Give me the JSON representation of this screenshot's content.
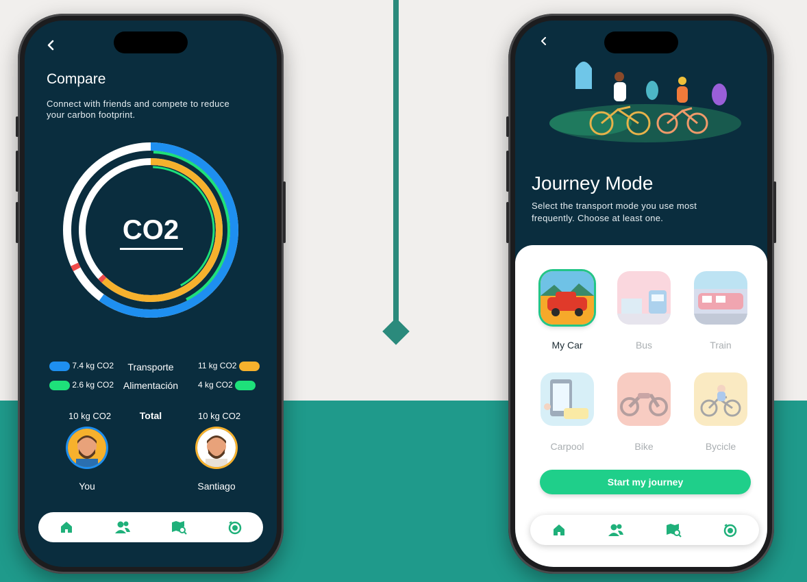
{
  "left_screen": {
    "title": "Compare",
    "subtitle": "Connect with friends and compete to reduce your carbon footprint.",
    "center_label": "CO2",
    "legend": [
      {
        "left_value": "7.4 kg CO2",
        "category": "Transporte",
        "right_value": "11 kg CO2",
        "left_color": "#1e8ff0",
        "right_color": "#f6b12d"
      },
      {
        "left_value": "2.6 kg CO2",
        "category": "Alimentación",
        "right_value": "4 kg CO2",
        "left_color": "#1ee07a",
        "right_color": "#1ee07a"
      }
    ],
    "total": {
      "left_value": "10 kg CO2",
      "label": "Total",
      "right_value": "10 kg CO2"
    },
    "users": [
      {
        "name": "You",
        "ring_color": "#1e8ff0"
      },
      {
        "name": "Santiago",
        "ring_color": "#f6b12d"
      }
    ],
    "nav": [
      "home-icon",
      "friends-icon",
      "map-search-icon",
      "history-icon"
    ]
  },
  "right_screen": {
    "title": "Journey Mode",
    "subtitle": "Select the transport mode you use most frequently. Choose at least one.",
    "modes": [
      {
        "label": "My Car",
        "selected": true
      },
      {
        "label": "Bus",
        "selected": false
      },
      {
        "label": "Train",
        "selected": false
      },
      {
        "label": "Carpool",
        "selected": false
      },
      {
        "label": "Bike",
        "selected": false
      },
      {
        "label": "Bycicle",
        "selected": false
      }
    ],
    "start_button": "Start my journey",
    "nav": [
      "home-icon",
      "friends-icon",
      "map-search-icon",
      "history-icon"
    ]
  },
  "colors": {
    "accent": "#1fcf8a",
    "screen_bg": "#0a2d3e",
    "page_teal": "#1f9a8b",
    "blue": "#1e8ff0",
    "yellow": "#f6b12d",
    "green": "#1ee07a"
  }
}
